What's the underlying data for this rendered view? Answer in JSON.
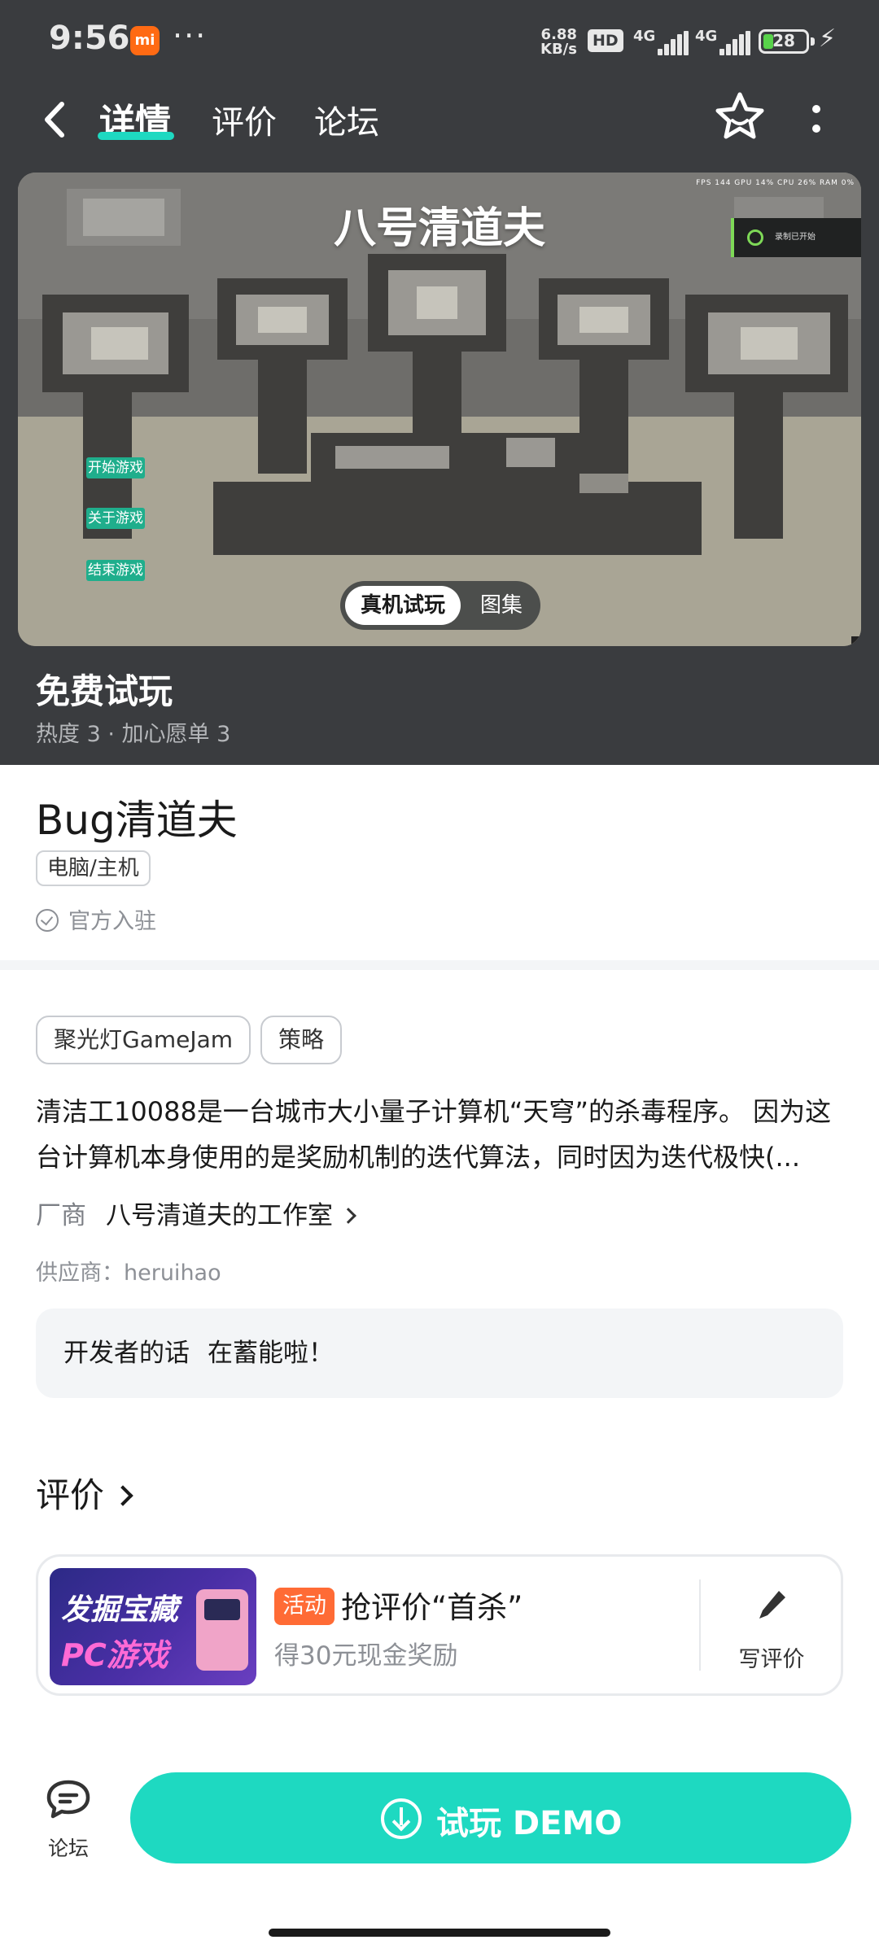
{
  "status_bar": {
    "time": "9:56",
    "mi_badge": "mi",
    "dots": "···",
    "net_speed_value": "6.88",
    "net_speed_unit": "KB/s",
    "hd": "HD",
    "net1": "4G",
    "net2": "4G",
    "battery": "28"
  },
  "nav": {
    "tabs": [
      "详情",
      "评价",
      "论坛"
    ],
    "active_tab": "详情"
  },
  "media": {
    "game_title": "八号清道夫",
    "overlay_stats": "FPS 144   GPU 14%   CPU 26%   RAM 0%",
    "toast": "录制已开始",
    "menu_buttons": [
      "开始游戏",
      "关于游戏",
      "结束游戏"
    ],
    "switch_tabs": [
      "真机试玩",
      "图集"
    ]
  },
  "trial": {
    "title": "免费试玩",
    "heat": "热度 3  ·  加心愿单 3"
  },
  "app": {
    "name": "Bug清道夫",
    "platform": "电脑/主机",
    "official": "官方入驻"
  },
  "tags": [
    "聚光灯GameJam",
    "策略"
  ],
  "description": "清洁工10088是一台城市大小量子计算机“天穹”的杀毒程序。 因为这台计算机本身使用的是奖励机制的迭代算法，同时因为迭代极快(...",
  "vendor": {
    "label": "厂商",
    "name": "八号清道夫的工作室"
  },
  "supplier": "供应商：heruihao",
  "developer_note": {
    "label": "开发者的话",
    "text": "在蓄能啦！"
  },
  "reviews": {
    "heading": "评价",
    "promo": {
      "image_line1": "发掘宝藏",
      "image_line2": "PC游戏",
      "badge": "活动",
      "title": "抢评价“首杀”",
      "subtitle": "得30元现金奖励",
      "write_label": "写评价"
    }
  },
  "bottom_bar": {
    "forum_label": "论坛",
    "demo_label": "试玩 DEMO"
  },
  "colors": {
    "accent": "#1ed9c1",
    "header_bg": "#3a3c3f",
    "activity_badge": "#ff6b35"
  }
}
